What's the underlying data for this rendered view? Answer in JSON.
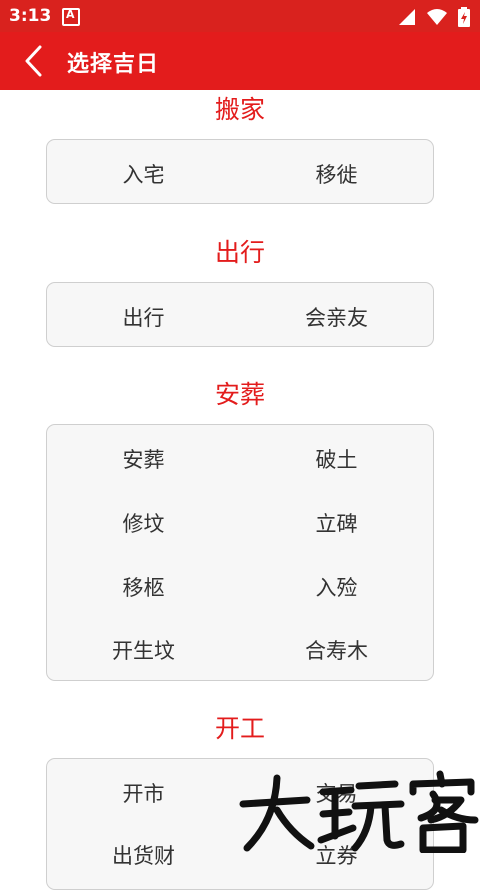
{
  "status_bar": {
    "time": "3:13",
    "notif_letter": "A"
  },
  "app_bar": {
    "title": "选择吉日"
  },
  "sections": [
    {
      "title": "搬家",
      "rows": [
        [
          "入宅",
          "移徙"
        ]
      ]
    },
    {
      "title": "出行",
      "rows": [
        [
          "出行",
          "会亲友"
        ]
      ]
    },
    {
      "title": "安葬",
      "rows": [
        [
          "安葬",
          "破土"
        ],
        [
          "修坟",
          "立碑"
        ],
        [
          "移柩",
          "入殓"
        ],
        [
          "开生坟",
          "合寿木"
        ]
      ]
    },
    {
      "title": "开工",
      "rows": [
        [
          "开市",
          "交易"
        ],
        [
          "出货财",
          "立券"
        ]
      ]
    }
  ],
  "watermark": "大玩客"
}
